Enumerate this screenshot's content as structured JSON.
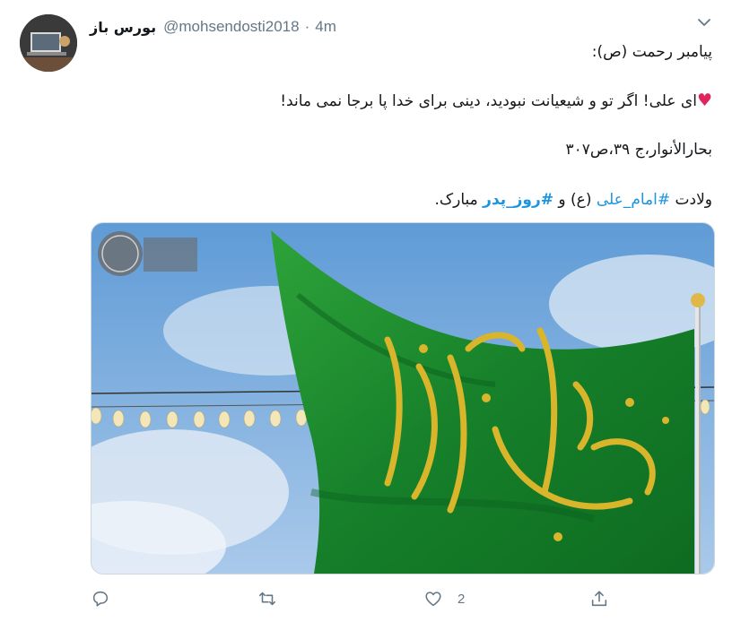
{
  "tweet": {
    "author_name": "بورس باز",
    "handle": "@mohsendosti2018",
    "separator": "·",
    "time": "4m",
    "lines": {
      "line1": "پیامبر رحمت (ص):",
      "line2": "ای علی! اگر تو و شیعیانت نبودید، دینی برای خدا پا برجا نمی ماند!",
      "line3": "بحارالأنوار،ج ۳۹،ص۳۰۷",
      "line4_prefix": "ولادت ",
      "line4_tag1": "#امام_علی",
      "line4_mid": " (ع) و ",
      "line4_tag2": "#روز_پدر",
      "line4_suffix": " مبارک."
    },
    "like_count": "2"
  },
  "colors": {
    "link": "#1b95e0",
    "muted": "#657786",
    "heart": "#e0245e",
    "flag_green": "#1f8a2c",
    "sky": "#6fa6dc"
  },
  "icons": {
    "reply": "reply-icon",
    "retweet": "retweet-icon",
    "like": "heart-icon",
    "share": "share-icon",
    "caret": "chevron-down-icon"
  }
}
